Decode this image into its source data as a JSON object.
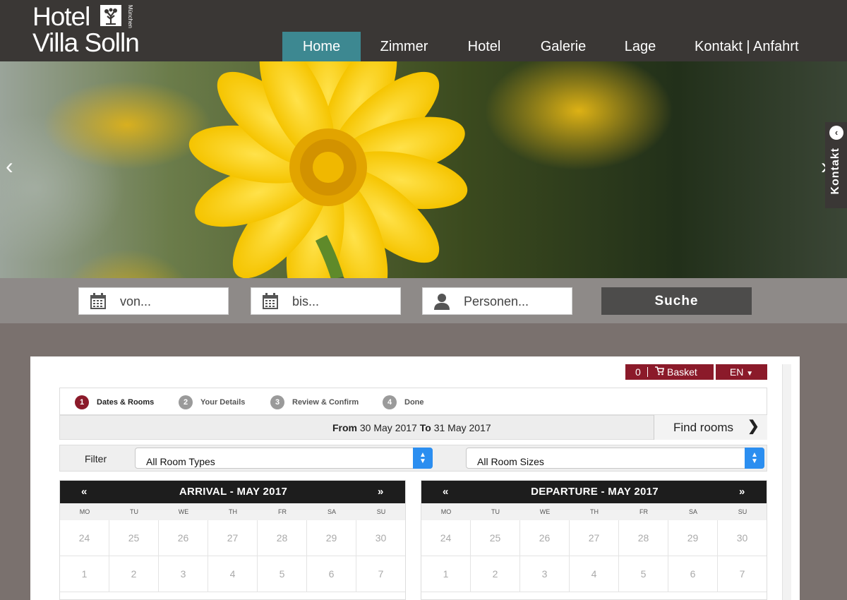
{
  "header": {
    "logo_line1": "Hotel",
    "logo_line2": "Villa Solln",
    "logo_small": "München",
    "nav": [
      {
        "label": "Home",
        "active": true
      },
      {
        "label": "Zimmer"
      },
      {
        "label": "Hotel"
      },
      {
        "label": "Galerie"
      },
      {
        "label": "Lage"
      },
      {
        "label": "Kontakt | Anfahrt"
      }
    ],
    "bg_color": "#3a3735",
    "active_color": "#3d8891"
  },
  "hero": {
    "prev_arrow": "‹",
    "next_arrow": "›",
    "side_tab_label": "Kontakt",
    "side_tab_icon": "chevron-left-icon"
  },
  "search": {
    "from_placeholder": "von...",
    "to_placeholder": "bis...",
    "persons_placeholder": "Personen...",
    "button_label": "Suche"
  },
  "booking": {
    "basket_count": "0",
    "basket_label": "Basket",
    "language": "EN",
    "steps": [
      {
        "num": "1",
        "label": "Dates & Rooms",
        "active": true
      },
      {
        "num": "2",
        "label": "Your Details"
      },
      {
        "num": "3",
        "label": "Review & Confirm"
      },
      {
        "num": "4",
        "label": "Done"
      }
    ],
    "date_range": {
      "from_label": "From",
      "from_date": "30 May 2017",
      "to_label": "To",
      "to_date": "31 May 2017"
    },
    "find_rooms_label": "Find rooms",
    "filter_label": "Filter",
    "room_type_value": "All Room Types",
    "room_size_value": "All Room Sizes",
    "accent_color": "#8b1a2a"
  },
  "calendars": [
    {
      "title": "ARRIVAL - MAY 2017",
      "prev": "«",
      "next": "»",
      "weekdays": [
        "MO",
        "TU",
        "WE",
        "TH",
        "FR",
        "SA",
        "SU"
      ],
      "rows": [
        [
          "24",
          "25",
          "26",
          "27",
          "28",
          "29",
          "30"
        ],
        [
          "1",
          "2",
          "3",
          "4",
          "5",
          "6",
          "7"
        ]
      ]
    },
    {
      "title": "DEPARTURE - MAY 2017",
      "prev": "«",
      "next": "»",
      "weekdays": [
        "MO",
        "TU",
        "WE",
        "TH",
        "FR",
        "SA",
        "SU"
      ],
      "rows": [
        [
          "24",
          "25",
          "26",
          "27",
          "28",
          "29",
          "30"
        ],
        [
          "1",
          "2",
          "3",
          "4",
          "5",
          "6",
          "7"
        ]
      ]
    }
  ]
}
